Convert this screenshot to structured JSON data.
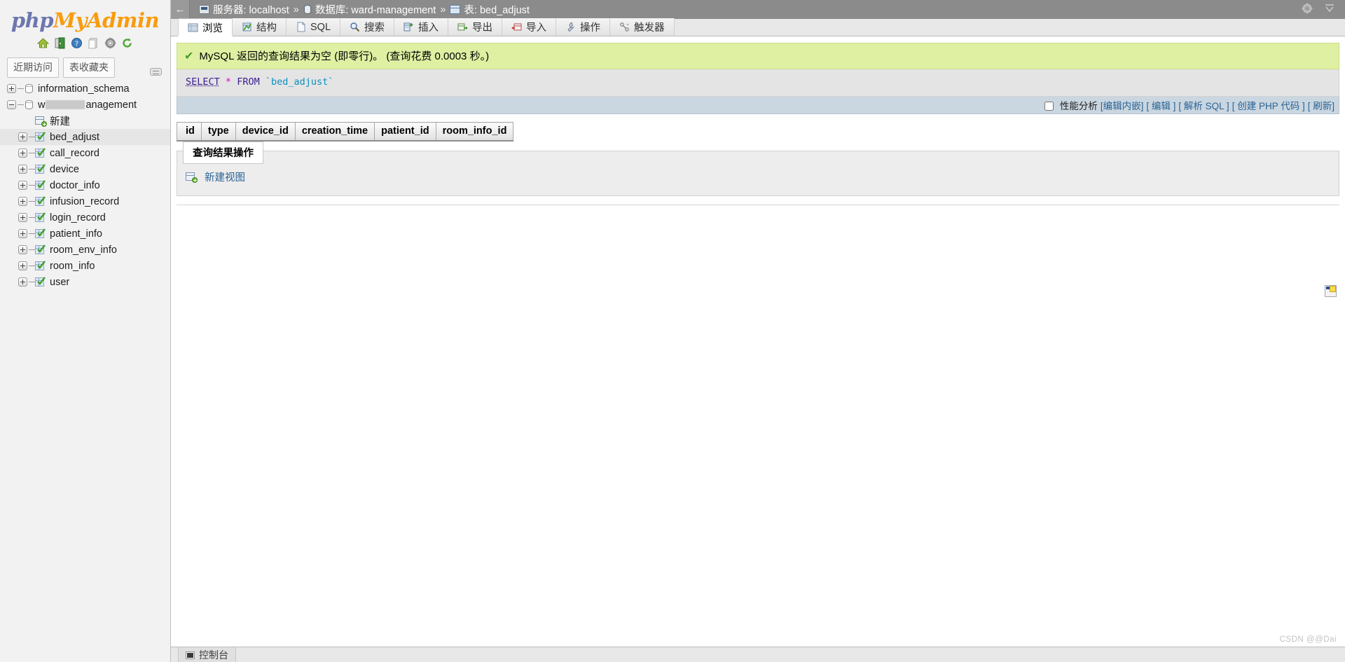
{
  "brand": {
    "php": "php",
    "my": "My",
    "admin": "Admin"
  },
  "brand_icons": [
    {
      "name": "home-icon",
      "glyph": "home"
    },
    {
      "name": "logout-icon",
      "glyph": "logout"
    },
    {
      "name": "help-icon",
      "glyph": "help"
    },
    {
      "name": "docs-icon",
      "glyph": "docs"
    },
    {
      "name": "settings-icon",
      "glyph": "gear"
    },
    {
      "name": "reload-icon",
      "glyph": "reload"
    }
  ],
  "sidebar": {
    "tabs": [
      {
        "label": "近期访问"
      },
      {
        "label": "表收藏夹"
      }
    ],
    "tree": [
      {
        "label": "information_schema",
        "type": "db",
        "expander": "plus",
        "indent": 0,
        "selected": false
      },
      {
        "label_prefix": "w",
        "label_suffix": "anagement",
        "redacted": true,
        "type": "db",
        "expander": "minus",
        "indent": 0,
        "selected": false
      },
      {
        "label": "新建",
        "type": "new",
        "expander": "none",
        "indent": 1,
        "selected": false
      },
      {
        "label": "bed_adjust",
        "type": "table",
        "expander": "plus",
        "indent": 1,
        "selected": true
      },
      {
        "label": "call_record",
        "type": "table",
        "expander": "plus",
        "indent": 1,
        "selected": false
      },
      {
        "label": "device",
        "type": "table",
        "expander": "plus",
        "indent": 1,
        "selected": false
      },
      {
        "label": "doctor_info",
        "type": "table",
        "expander": "plus",
        "indent": 1,
        "selected": false
      },
      {
        "label": "infusion_record",
        "type": "table",
        "expander": "plus",
        "indent": 1,
        "selected": false
      },
      {
        "label": "login_record",
        "type": "table",
        "expander": "plus",
        "indent": 1,
        "selected": false
      },
      {
        "label": "patient_info",
        "type": "table",
        "expander": "plus",
        "indent": 1,
        "selected": false
      },
      {
        "label": "room_env_info",
        "type": "table",
        "expander": "plus",
        "indent": 1,
        "selected": false
      },
      {
        "label": "room_info",
        "type": "table",
        "expander": "plus",
        "indent": 1,
        "selected": false
      },
      {
        "label": "user",
        "type": "table",
        "expander": "plus",
        "indent": 1,
        "selected": false
      }
    ]
  },
  "breadcrumb": {
    "back_glyph": "←",
    "server_label": "服务器: localhost",
    "sep1": "»",
    "database_label": "数据库: ward-management",
    "sep2": "»",
    "table_label": "表: bed_adjust",
    "settings_icon": "gear-icon",
    "collapse_icon": "collapse-icon"
  },
  "tabs": [
    {
      "label": "浏览",
      "icon": "browse-icon",
      "active": true
    },
    {
      "label": "结构",
      "icon": "structure-icon",
      "active": false
    },
    {
      "label": "SQL",
      "icon": "sql-icon",
      "active": false
    },
    {
      "label": "搜索",
      "icon": "search-icon",
      "active": false
    },
    {
      "label": "插入",
      "icon": "insert-icon",
      "active": false
    },
    {
      "label": "导出",
      "icon": "export-icon",
      "active": false
    },
    {
      "label": "导入",
      "icon": "import-icon",
      "active": false
    },
    {
      "label": "操作",
      "icon": "operations-icon",
      "active": false
    },
    {
      "label": "触发器",
      "icon": "triggers-icon",
      "active": false
    }
  ],
  "message": {
    "icon": "success-check-icon",
    "text": "MySQL 返回的查询结果为空 (即零行)。 (查询花费 0.0003 秒。)"
  },
  "sql": {
    "keyword": "SELECT",
    "star": "*",
    "from": "FROM",
    "table": "`bed_adjust`"
  },
  "linkbar": {
    "profiling_label": "性能分析",
    "inline_edit": "[编辑内嵌]",
    "edit": "[ 编辑 ]",
    "explain": "[ 解析 SQL ]",
    "php": "[ 创建 PHP 代码 ]",
    "refresh": "[ 刷新]"
  },
  "results": {
    "columns": [
      "id",
      "type",
      "device_id",
      "creation_time",
      "patient_id",
      "room_info_id"
    ],
    "rows": []
  },
  "query_ops": {
    "legend": "查询结果操作",
    "create_view_label": "新建视图",
    "create_view_icon": "create-view-icon"
  },
  "console": {
    "label": "控制台",
    "icon": "console-icon"
  },
  "watermark": "CSDN @@Dai",
  "colors": {
    "success_bg": "#dff0a2",
    "sql_bg": "#e4e4e4",
    "linkbar_bg": "#cad6e0",
    "topbar_bg": "#8b8b8b",
    "sidebar_bg": "#f2f2f2",
    "link": "#2a6496",
    "brand_orange": "#f89c0e",
    "brand_blue": "#6c76af"
  }
}
